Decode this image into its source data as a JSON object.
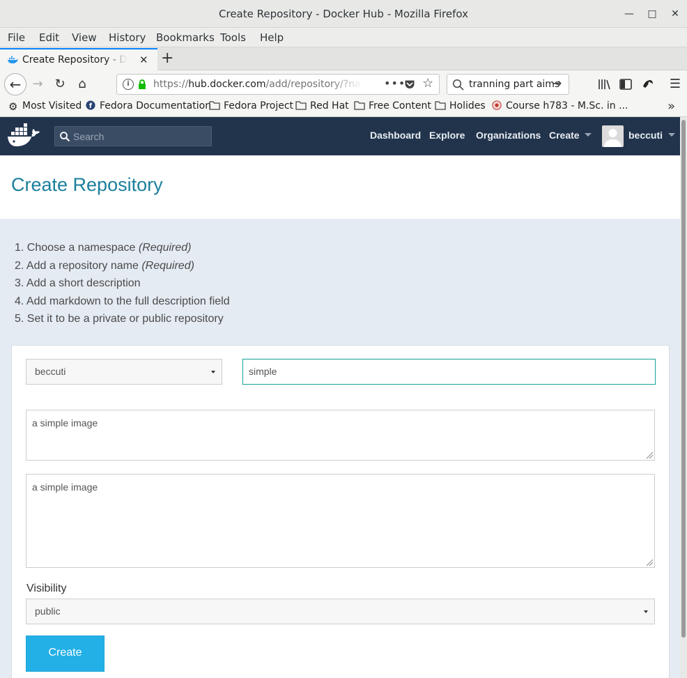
{
  "window": {
    "title": "Create Repository - Docker Hub - Mozilla Firefox",
    "buttons": {
      "minimize": "—",
      "maximize": "□",
      "close": "✕"
    }
  },
  "menu": [
    "File",
    "Edit",
    "View",
    "History",
    "Bookmarks",
    "Tools",
    "Help"
  ],
  "tab": {
    "label": "Create Repository - Docker Hub",
    "close": "✕",
    "new": "+"
  },
  "toolbar": {
    "url_host": "hub.docker.com",
    "url_prefix": "https://",
    "url_path": "/add/repository/?name",
    "more": "•••",
    "search_value": "tranning part aims"
  },
  "bookmarks": [
    {
      "label": "Most Visited",
      "icon": "gear-icon"
    },
    {
      "label": "Fedora Documentation",
      "icon": "fedora-icon"
    },
    {
      "label": "Fedora Project",
      "icon": "folder-icon"
    },
    {
      "label": "Red Hat",
      "icon": "folder-icon"
    },
    {
      "label": "Free Content",
      "icon": "folder-icon"
    },
    {
      "label": "Holides",
      "icon": "folder-icon"
    },
    {
      "label": "Course h783 - M.Sc. in ...",
      "icon": "course-icon"
    }
  ],
  "dockerhub": {
    "search_placeholder": "Search",
    "nav": [
      "Dashboard",
      "Explore",
      "Organizations",
      "Create"
    ],
    "user": "beccuti",
    "colors": {
      "nav_bg": "#22344c",
      "accent": "#1b7f9c",
      "button": "#23b0e6"
    }
  },
  "page": {
    "title": "Create Repository",
    "steps": [
      {
        "text": "1. Choose a namespace ",
        "note": "(Required)"
      },
      {
        "text": "2. Add a repository name ",
        "note": "(Required)"
      },
      {
        "text": "3. Add a short description",
        "note": ""
      },
      {
        "text": "4. Add markdown to the full description field",
        "note": ""
      },
      {
        "text": "5. Set it to be a private or public repository",
        "note": ""
      }
    ]
  },
  "form": {
    "namespace": "beccuti",
    "name": "simple",
    "short_description": "a simple image",
    "full_description": "a simple image",
    "visibility_label": "Visibility",
    "visibility": "public",
    "submit": "Create"
  }
}
